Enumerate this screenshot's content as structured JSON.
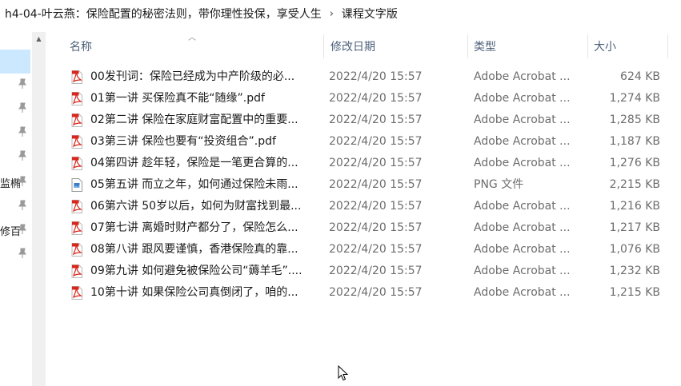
{
  "breadcrumb": {
    "items": [
      "h4-04-叶云燕：保险配置的秘密法则，带你理性投保，享受人生",
      "课程文字版"
    ],
    "separator": "›"
  },
  "nav": {
    "labels": [
      "监椭",
      "修百"
    ]
  },
  "columns": {
    "name": "名称",
    "date": "修改日期",
    "type": "类型",
    "size": "大小"
  },
  "files": [
    {
      "name": "00发刊词：保险已经成为中产阶级的必...",
      "date": "2022/4/20 15:57",
      "type": "Adobe Acrobat ...",
      "size": "624 KB",
      "icon": "pdf-icon"
    },
    {
      "name": "01第一讲 买保险真不能“随缘”.pdf",
      "date": "2022/4/20 15:57",
      "type": "Adobe Acrobat ...",
      "size": "1,274 KB",
      "icon": "pdf-icon"
    },
    {
      "name": "02第二讲 保险在家庭财富配置中的重要...",
      "date": "2022/4/20 15:57",
      "type": "Adobe Acrobat ...",
      "size": "1,285 KB",
      "icon": "pdf-icon"
    },
    {
      "name": "03第三讲 保险也要有“投资组合”.pdf",
      "date": "2022/4/20 15:57",
      "type": "Adobe Acrobat ...",
      "size": "1,187 KB",
      "icon": "pdf-icon"
    },
    {
      "name": "04第四讲 趁年轻，保险是一笔更合算的...",
      "date": "2022/4/20 15:57",
      "type": "Adobe Acrobat ...",
      "size": "1,276 KB",
      "icon": "pdf-icon"
    },
    {
      "name": "05第五讲 而立之年，如何通过保险未雨...",
      "date": "2022/4/20 15:57",
      "type": "PNG 文件",
      "size": "2,215 KB",
      "icon": "png-icon"
    },
    {
      "name": "06第六讲 50岁以后，如何为财富找到最...",
      "date": "2022/4/20 15:57",
      "type": "Adobe Acrobat ...",
      "size": "1,216 KB",
      "icon": "pdf-icon"
    },
    {
      "name": "07第七讲 离婚时财产都分了，保险怎么...",
      "date": "2022/4/20 15:57",
      "type": "Adobe Acrobat ...",
      "size": "1,217 KB",
      "icon": "pdf-icon"
    },
    {
      "name": "08第八讲 跟风要谨慎，香港保险真的靠...",
      "date": "2022/4/20 15:57",
      "type": "Adobe Acrobat ...",
      "size": "1,076 KB",
      "icon": "pdf-icon"
    },
    {
      "name": "09第九讲 如何避免被保险公司“薅羊毛”....",
      "date": "2022/4/20 15:57",
      "type": "Adobe Acrobat ...",
      "size": "1,232 KB",
      "icon": "pdf-icon"
    },
    {
      "name": "10第十讲 如果保险公司真倒闭了，咱的...",
      "date": "2022/4/20 15:57",
      "type": "Adobe Acrobat ...",
      "size": "1,215 KB",
      "icon": "pdf-icon"
    }
  ],
  "colors": {
    "header_text": "#4c607a",
    "secondary_text": "#6d6d6d",
    "nav_selected": "#cce8ff",
    "pdf_red": "#d8261c"
  }
}
